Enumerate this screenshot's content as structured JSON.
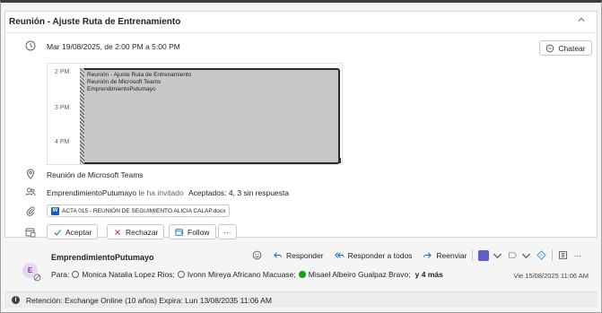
{
  "meeting": {
    "title": "Reunión - Ajuste Ruta de Entrenamiento",
    "datetime": "Mar 19/08/2025, de 2:00 PM a 5:00 PM",
    "chat_label": "Chatear",
    "calendar": {
      "hours": [
        "2 PM",
        "3 PM",
        "4 PM"
      ],
      "event_lines": [
        "Reunión - Ajuste Ruta de Entrenamiento",
        "Reunión de Microsoft Teams",
        "EmprendimientoPutumayo"
      ]
    },
    "location": "Reunión de Microsoft Teams",
    "organizer": "EmprendimientoPutumayo",
    "invited_text": "le ha invitado",
    "accepted_text": "Aceptados: 4, 3 sin respuesta",
    "attachment": "ACTA 015 - REUNIÓN DE SEGUIMIENTO ALICIA CALAP.docx",
    "responses": {
      "accept": "Aceptar",
      "decline": "Rechazar",
      "follow": "Follow",
      "more": "···"
    }
  },
  "message": {
    "avatar_initial": "E",
    "sender": "EmprendimientoPutumayo",
    "actions": {
      "reply": "Responder",
      "reply_all": "Responder a todos",
      "forward": "Reenviar",
      "more": "···"
    },
    "to_label": "Para:",
    "recipients": [
      "Monica Natalia Lopez Rios;",
      "Ivonn Mireya Africano Macuase;",
      "Misael Albeiro Gualpaz Bravo;"
    ],
    "more_recipients": "y 4 más",
    "date": "Vie 15/08/2025 11:06 AM"
  },
  "retention": {
    "text": "Retención: Exchange Online (10 años) Expira: Lun 13/08/2035 11:06 AM"
  },
  "colors": {
    "accent": "#0f6cbd",
    "accept": "#13a10e",
    "decline": "#c4314b",
    "avatar_bg": "#e7d6f0"
  }
}
